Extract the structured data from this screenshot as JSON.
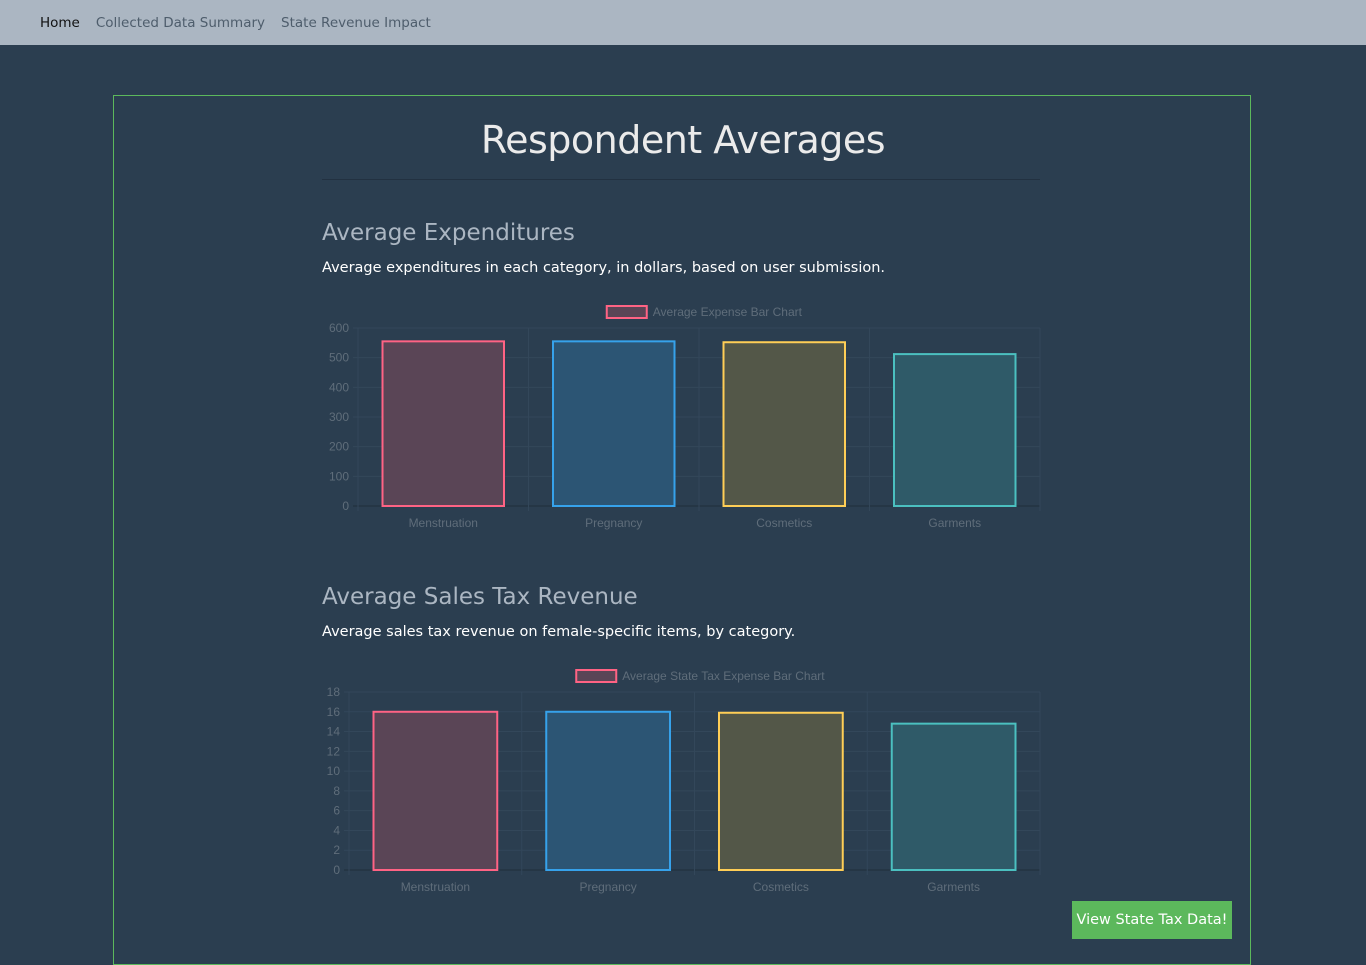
{
  "nav": {
    "items": [
      "Home",
      "Collected Data Summary",
      "State Revenue Impact"
    ]
  },
  "page": {
    "title": "Respondent Averages"
  },
  "sections": [
    {
      "title": "Average Expenditures",
      "description": "Average expenditures in each category, in dollars, based on user submission."
    },
    {
      "title": "Average Sales Tax Revenue",
      "description": "Average sales tax revenue on female-specific items, by category."
    }
  ],
  "button": {
    "label": "View State Tax Data!"
  },
  "chart_data": [
    {
      "type": "bar",
      "legend": "Average Expense Bar Chart",
      "legend_position": "top",
      "categories": [
        "Menstruation",
        "Pregnancy",
        "Cosmetics",
        "Garments"
      ],
      "values": [
        555,
        555,
        552,
        512
      ],
      "ylim": [
        0,
        600
      ],
      "yticks": [
        0,
        100,
        200,
        300,
        400,
        500,
        600
      ],
      "grid": true,
      "colors": {
        "stroke": [
          "#ff6384",
          "#36a2eb",
          "#ffce56",
          "#4bc0c0"
        ],
        "fill": [
          "#5a4556",
          "#2c5574",
          "#535748",
          "#2f5a68"
        ]
      }
    },
    {
      "type": "bar",
      "legend": "Average State Tax Expense Bar Chart",
      "legend_position": "top",
      "categories": [
        "Menstruation",
        "Pregnancy",
        "Cosmetics",
        "Garments"
      ],
      "values": [
        16.0,
        16.0,
        15.9,
        14.8
      ],
      "ylim": [
        0,
        18
      ],
      "yticks": [
        0,
        2,
        4,
        6,
        8,
        10,
        12,
        14,
        16,
        18
      ],
      "grid": true,
      "colors": {
        "stroke": [
          "#ff6384",
          "#36a2eb",
          "#ffce56",
          "#4bc0c0"
        ],
        "fill": [
          "#5a4556",
          "#2c5574",
          "#535748",
          "#2f5a68"
        ]
      }
    }
  ]
}
